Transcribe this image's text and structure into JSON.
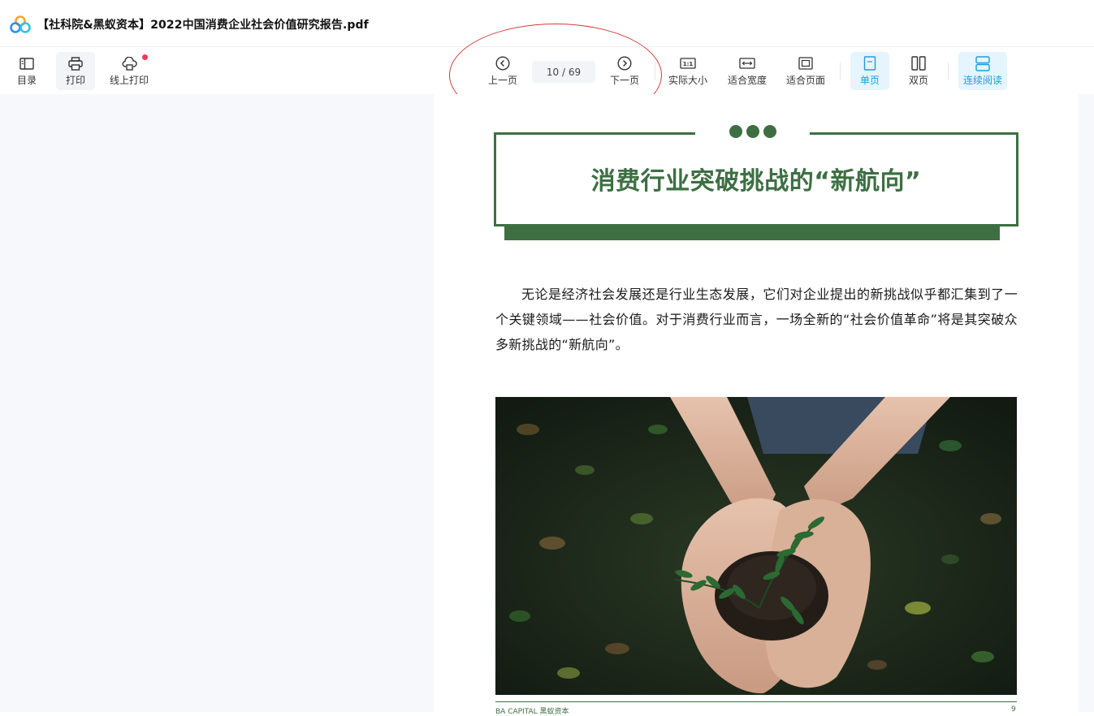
{
  "window": {
    "title": "【社科院&黑蚁资本】2022中国消费企业社会价值研究报告.pdf"
  },
  "toolbar": {
    "toc_label": "目录",
    "print_label": "打印",
    "online_print_label": "线上打印",
    "prev_label": "上一页",
    "next_label": "下一页",
    "page_indicator": "10 / 69",
    "actual_size_label": "实际大小",
    "fit_width_label": "适合宽度",
    "fit_page_label": "适合页面",
    "single_page_label": "单页",
    "double_page_label": "双页",
    "continuous_label": "连续阅读",
    "active_view_mode": "单页",
    "active_scroll_mode": "连续阅读"
  },
  "document": {
    "heading": "消费行业突破挑战的“新航向”",
    "paragraph": "无论是经济社会发展还是行业生态发展，它们对企业提出的新挑战似乎都汇集到了一个关键领域——社会价值。对于消费行业而言，一场全新的“社会价值革命”将是其突破众多新挑战的“新航向”。",
    "footer_brand": "BA CAPITAL 黑蚁资本",
    "footer_page": "9"
  },
  "colors": {
    "accent_blue": "#1e9bdc",
    "doc_green": "#3d6f43",
    "notification_red": "#f0365a",
    "annotation_red": "#d43a3a"
  }
}
